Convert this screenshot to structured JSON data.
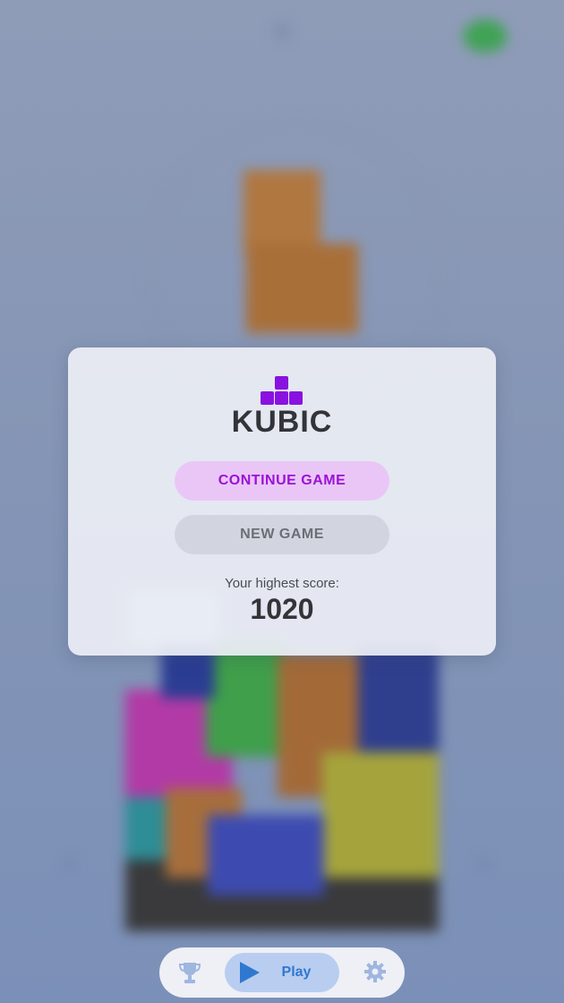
{
  "game": {
    "logo_name": "kubic-logo",
    "title": "KUBIC",
    "continue_label": "CONTINUE GAME",
    "new_game_label": "NEW GAME",
    "score_label": "Your highest score:",
    "highest_score": "1020"
  },
  "bottom_bar": {
    "play_label": "Play",
    "icons": [
      "trophy-icon",
      "play-icon",
      "gear-icon"
    ]
  },
  "colors": {
    "accent_purple": "#8a12e0",
    "continue_bg": "#eac6f6",
    "play_blue": "#2f78d0",
    "background": "#8595b5"
  }
}
